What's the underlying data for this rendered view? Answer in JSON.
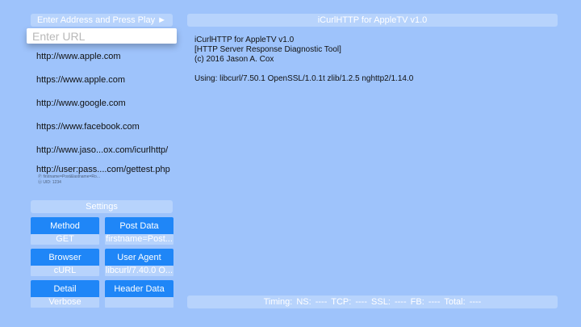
{
  "sidebar": {
    "address_label": "Enter Address and Press Play ►",
    "url_placeholder": "Enter URL",
    "urls": [
      "http://www.apple.com",
      "https://www.apple.com",
      "http://www.google.com",
      "https://www.facebook.com",
      "http://www.jaso...ox.com/icurlhttp/",
      "http://user:pass....com/gettest.php"
    ],
    "url_details": [
      "Ⓟ firstname=Post&lastname=Ro...",
      "Ⓤ UID: 1234"
    ],
    "settings_label": "Settings",
    "settings": [
      {
        "label": "Method",
        "value": "GET"
      },
      {
        "label": "Post Data",
        "value": "firstname=Post..."
      },
      {
        "label": "Browser",
        "value": "cURL"
      },
      {
        "label": "User Agent",
        "value": "libcurl/7.40.0 O..."
      },
      {
        "label": "Detail",
        "value": "Verbose"
      },
      {
        "label": "Header Data",
        "value": ""
      }
    ]
  },
  "main": {
    "title": "iCurlHTTP for AppleTV v1.0",
    "info_lines": [
      "iCurlHTTP for AppleTV v1.0",
      "[HTTP Server Response Diagnostic Tool]",
      "(c) 2016 Jason A. Cox",
      "",
      "Using: libcurl/7.50.1 OpenSSL/1.0.1t zlib/1.2.5 nghttp2/1.14.0"
    ],
    "timing": "Timing:  NS: ----   TCP: ----   SSL: ----   FB: ----   Total: ----"
  },
  "colors": {
    "background": "#9ec3fb",
    "panel": "#b7d3fc",
    "button": "#1f86f7"
  }
}
